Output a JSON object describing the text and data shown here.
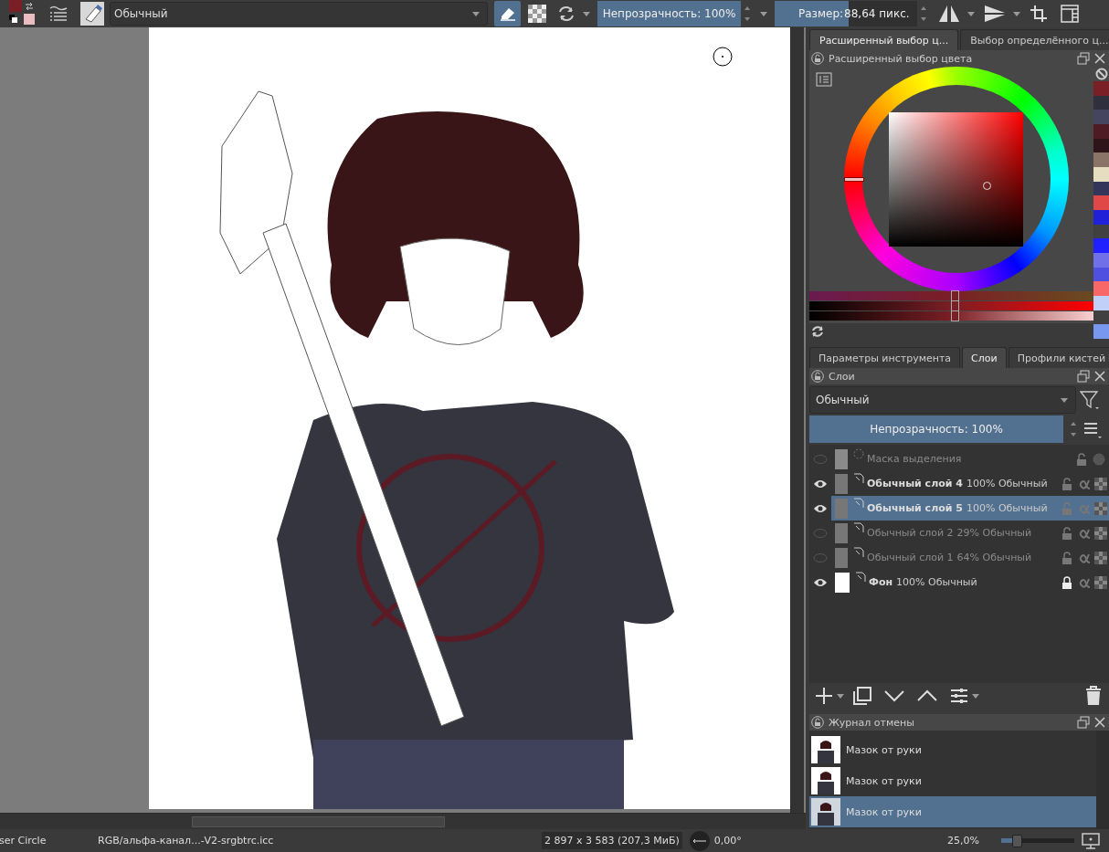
{
  "toolbar": {
    "swatches": [
      {
        "kind": "foreground",
        "color": "#7a1f25"
      },
      {
        "kind": "background",
        "color": "#ebbcc0"
      }
    ],
    "blend_mode": "Обычный",
    "eraser_mode": {
      "selected": true
    },
    "opacity": {
      "label": "Непрозрачность: 100%",
      "level": 1
    },
    "size": {
      "label": "Размер:",
      "value": "88,64 пикс.",
      "level": 0.52
    }
  },
  "color_dock": {
    "tabs": [
      {
        "label": "Расширенный выбор ц...",
        "selected": true
      },
      {
        "label": "Выбор определённого ц...",
        "selected": false
      }
    ],
    "title": "Расширенный выбор цвета",
    "sliders": [
      {
        "level": 0.51
      },
      {
        "level": 0.51
      },
      {
        "level": 0.51
      }
    ],
    "palette": [
      {
        "color": "#7a1f25"
      },
      {
        "color": "#2f2f3d"
      },
      {
        "color": "#454560"
      },
      {
        "color": "#4e1a24"
      },
      {
        "color": "#2e1519"
      },
      {
        "color": "#8a7468"
      },
      {
        "color": "#e6dcc0"
      },
      {
        "color": "#33355a"
      },
      {
        "color": "#e04848"
      },
      {
        "color": "#2020d8"
      },
      {
        "color": "#404040"
      },
      {
        "color": "#2020ff"
      },
      {
        "color": "#7070e8"
      },
      {
        "color": "#5050e0"
      },
      {
        "color": "#f86868"
      },
      {
        "color": "#c0d0f8"
      },
      {
        "color": "#404040"
      },
      {
        "color": "#7898f0"
      }
    ]
  },
  "tool_dock": {
    "tabs": [
      {
        "label": "Параметры инструмента",
        "selected": false
      },
      {
        "label": "Слои",
        "selected": true
      },
      {
        "label": "Профили кистей",
        "selected": false
      }
    ]
  },
  "layers": {
    "title": "Слои",
    "blend_mode": "Обычный",
    "opacity": {
      "label": "Непрозрачность:  100%",
      "level": 1
    },
    "items": [
      {
        "kind": "mask",
        "name": "Маска выделения",
        "visible": false,
        "selected": false,
        "locked": false
      },
      {
        "kind": "paint",
        "name": "Обычный слой 4",
        "info": "100% Обычный",
        "visible": true,
        "selected": false,
        "locked": false
      },
      {
        "kind": "paint",
        "name": "Обычный слой 5",
        "info": "100% Обычный",
        "visible": true,
        "selected": true,
        "locked": false
      },
      {
        "kind": "paint",
        "name": "Обычный слой 2",
        "info": "29% Обычный",
        "visible": false,
        "selected": false,
        "locked": false
      },
      {
        "kind": "paint",
        "name": "Обычный слой 1",
        "info": "64% Обычный",
        "visible": false,
        "selected": false,
        "locked": false
      },
      {
        "kind": "background",
        "name": "Фон",
        "info": "100% Обычный",
        "visible": true,
        "selected": false,
        "locked": true
      }
    ]
  },
  "undo_history": {
    "title": "Журнал отмены",
    "items": [
      {
        "label": "Мазок от руки",
        "selected": false
      },
      {
        "label": "Мазок от руки",
        "selected": false
      },
      {
        "label": "Мазок от руки",
        "selected": true
      }
    ]
  },
  "status_bar": {
    "tool": "ser Circle",
    "profile": "RGB/альфа-канал...-V2-srgbtrc.icc",
    "image_size": "2 897 x 3 583 (207,3 МиБ)",
    "rotation": "0,00°",
    "zoom": "25,0%",
    "zoom_slider": {
      "level": 0.23
    }
  }
}
